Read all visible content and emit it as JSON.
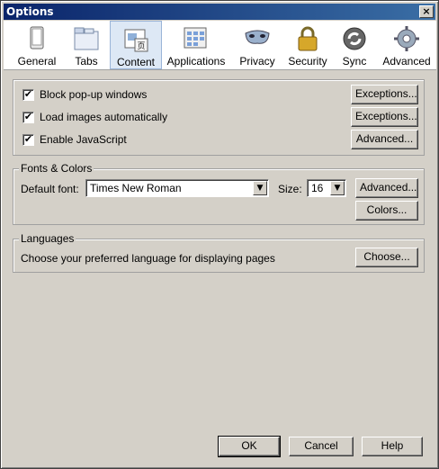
{
  "window": {
    "title": "Options",
    "close_glyph": "×"
  },
  "panes": [
    {
      "label": "General",
      "icon": "general-icon"
    },
    {
      "label": "Tabs",
      "icon": "tabs-icon"
    },
    {
      "label": "Content",
      "icon": "content-icon",
      "selected": true
    },
    {
      "label": "Applications",
      "icon": "applications-icon"
    },
    {
      "label": "Privacy",
      "icon": "privacy-mask-icon"
    },
    {
      "label": "Security",
      "icon": "security-lock-icon"
    },
    {
      "label": "Sync",
      "icon": "sync-icon"
    },
    {
      "label": "Advanced",
      "icon": "advanced-gear-icon"
    }
  ],
  "content": {
    "popups": {
      "label": "Block pop-up windows",
      "checked": true,
      "button": "Exceptions..."
    },
    "images": {
      "label": "Load images automatically",
      "checked": true,
      "button": "Exceptions..."
    },
    "javascript": {
      "label": "Enable JavaScript",
      "checked": true,
      "button": "Advanced..."
    }
  },
  "fonts": {
    "title": "Fonts & Colors",
    "default_font_label": "Default font:",
    "default_font_value": "Times New Roman",
    "size_label": "Size:",
    "size_value": "16",
    "advanced_button": "Advanced...",
    "colors_button": "Colors..."
  },
  "languages": {
    "title": "Languages",
    "description": "Choose your preferred language for displaying pages",
    "choose_button": "Choose..."
  },
  "footer": {
    "ok": "OK",
    "cancel": "Cancel",
    "help": "Help"
  },
  "check_glyph": "✔"
}
